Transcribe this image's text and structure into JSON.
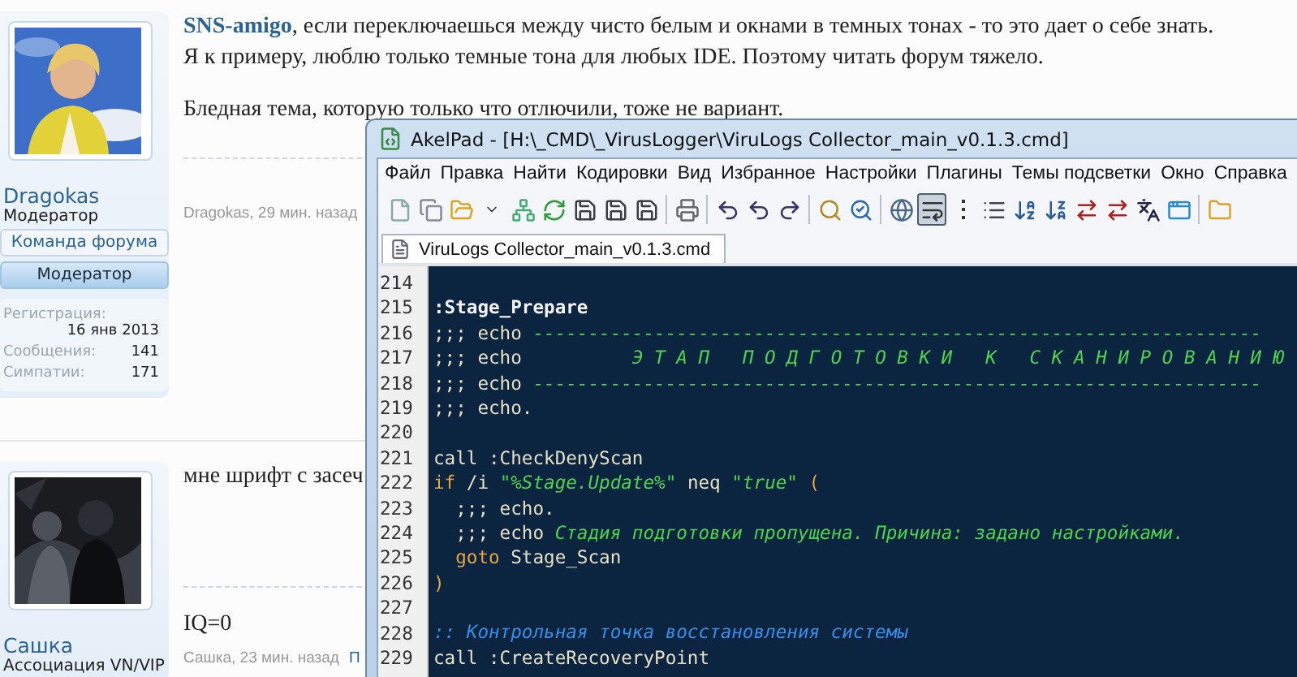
{
  "posts": [
    {
      "author": {
        "name": "Dragokas",
        "title": "Модератор",
        "badges": [
          {
            "label": "Команда форума",
            "kind": "team"
          },
          {
            "label": "Модератор",
            "kind": "role"
          }
        ],
        "stats": [
          {
            "label": "Регистрация:",
            "value": "16 янв 2013",
            "kind": "stacked"
          },
          {
            "label": "Сообщения:",
            "value": "141",
            "kind": "inline"
          },
          {
            "label": "Симпатии:",
            "value": "171",
            "kind": "inline"
          }
        ]
      },
      "mention": "SNS-amigo",
      "paragraphs": [
        ", если переключаешься между чисто белым и окнами в темных тонах - то это дает о себе знать.",
        "Я к примеру, люблю только темные тона для любых IDE. Поэтому читать форум тяжело.",
        "Бледная тема, которую только что отлючили, тоже не вариант."
      ],
      "meta": "Dragokas, 29 мин. назад"
    },
    {
      "author": {
        "name": "Сашка",
        "title": "Ассоциация VN/VIP"
      },
      "paragraphs": [
        "мне шрифт с засеч"
      ],
      "signature": "IQ=0",
      "meta": "Сашка, 23 мин. назад",
      "meta_link": "П"
    }
  ],
  "editor": {
    "title": "AkelPad - [H:\\_CMD\\_VirusLogger\\ViruLogs Collector_main_v0.1.3.cmd]",
    "menu": [
      "Файл",
      "Правка",
      "Найти",
      "Кодировки",
      "Вид",
      "Избранное",
      "Настройки",
      "Плагины",
      "Темы подсветки",
      "Окно",
      "Справка"
    ],
    "toolbar": [
      {
        "kind": "new",
        "pressed": false
      },
      {
        "kind": "copy",
        "pressed": false
      },
      {
        "kind": "open",
        "pressed": false
      },
      {
        "kind": "dropdown",
        "pressed": false
      },
      {
        "kind": "tree",
        "pressed": false
      },
      {
        "kind": "reload",
        "pressed": false
      },
      {
        "kind": "save",
        "pressed": false
      },
      {
        "kind": "save",
        "pressed": false
      },
      {
        "kind": "save",
        "pressed": false
      },
      {
        "kind": "separator"
      },
      {
        "kind": "print",
        "pressed": false
      },
      {
        "kind": "separator"
      },
      {
        "kind": "undo",
        "pressed": false
      },
      {
        "kind": "undo",
        "pressed": false
      },
      {
        "kind": "redo",
        "pressed": false
      },
      {
        "kind": "separator"
      },
      {
        "kind": "find",
        "pressed": false
      },
      {
        "kind": "replace",
        "pressed": false
      },
      {
        "kind": "separator"
      },
      {
        "kind": "globe",
        "pressed": false
      },
      {
        "kind": "wrap",
        "pressed": true
      },
      {
        "kind": "marker",
        "pressed": false
      },
      {
        "kind": "list",
        "pressed": false
      },
      {
        "kind": "sort-asc",
        "pressed": false
      },
      {
        "kind": "sort-desc",
        "pressed": false
      },
      {
        "kind": "convert",
        "pressed": false
      },
      {
        "kind": "convert",
        "pressed": false
      },
      {
        "kind": "encoding",
        "pressed": false
      },
      {
        "kind": "window",
        "pressed": false
      },
      {
        "kind": "separator"
      },
      {
        "kind": "folder",
        "pressed": false
      }
    ],
    "tabs": [
      {
        "label": "ViruLogs Collector_main_v0.1.3.cmd",
        "selected": true
      }
    ],
    "lines": [
      {
        "number": "214"
      },
      {
        "number": "215",
        "segments": [
          {
            "text": ":Stage_Prepare",
            "kind": "label"
          }
        ]
      },
      {
        "number": "216",
        "segments": [
          {
            "text": ";;; echo ",
            "kind": "plain"
          },
          {
            "text": "------------------------------------------------------------------",
            "kind": "echo-text"
          }
        ]
      },
      {
        "number": "217",
        "segments": [
          {
            "text": ";;; echo          ",
            "kind": "plain"
          },
          {
            "text": "Э Т А П   П О Д Г О Т О В К И   К   С К А Н И Р О В А Н И Ю",
            "kind": "echo-text"
          }
        ]
      },
      {
        "number": "218",
        "segments": [
          {
            "text": ";;; echo ",
            "kind": "plain"
          },
          {
            "text": "------------------------------------------------------------------",
            "kind": "echo-text"
          }
        ]
      },
      {
        "number": "219",
        "segments": [
          {
            "text": ";;; echo.",
            "kind": "plain"
          }
        ]
      },
      {
        "number": "220"
      },
      {
        "number": "221",
        "segments": [
          {
            "text": "call :CheckDenyScan",
            "kind": "plain"
          }
        ]
      },
      {
        "number": "222",
        "segments": [
          {
            "text": "if",
            "kind": "keyword"
          },
          {
            "text": " /i ",
            "kind": "plain"
          },
          {
            "text": "\"%Stage.Update%\"",
            "kind": "echo-text"
          },
          {
            "text": " neq ",
            "kind": "plain"
          },
          {
            "text": "\"true\"",
            "kind": "echo-text"
          },
          {
            "text": " (",
            "kind": "keyword"
          }
        ]
      },
      {
        "number": "223",
        "segments": [
          {
            "text": "  ;;; echo.",
            "kind": "plain"
          }
        ]
      },
      {
        "number": "224",
        "segments": [
          {
            "text": "  ;;; echo ",
            "kind": "plain"
          },
          {
            "text": "Стадия подготовки пропущена. Причина: задано настройками.",
            "kind": "echo-text"
          }
        ]
      },
      {
        "number": "225",
        "segments": [
          {
            "text": "  goto",
            "kind": "keyword"
          },
          {
            "text": " Stage_Scan",
            "kind": "plain"
          }
        ]
      },
      {
        "number": "226",
        "segments": [
          {
            "text": ")",
            "kind": "keyword"
          }
        ]
      },
      {
        "number": "227"
      },
      {
        "number": "228",
        "segments": [
          {
            "text": ":: Контрольная точка восстановления системы",
            "kind": "comment"
          }
        ]
      },
      {
        "number": "229",
        "segments": [
          {
            "text": "call :CreateRecoveryPoint",
            "kind": "plain"
          }
        ]
      }
    ]
  }
}
